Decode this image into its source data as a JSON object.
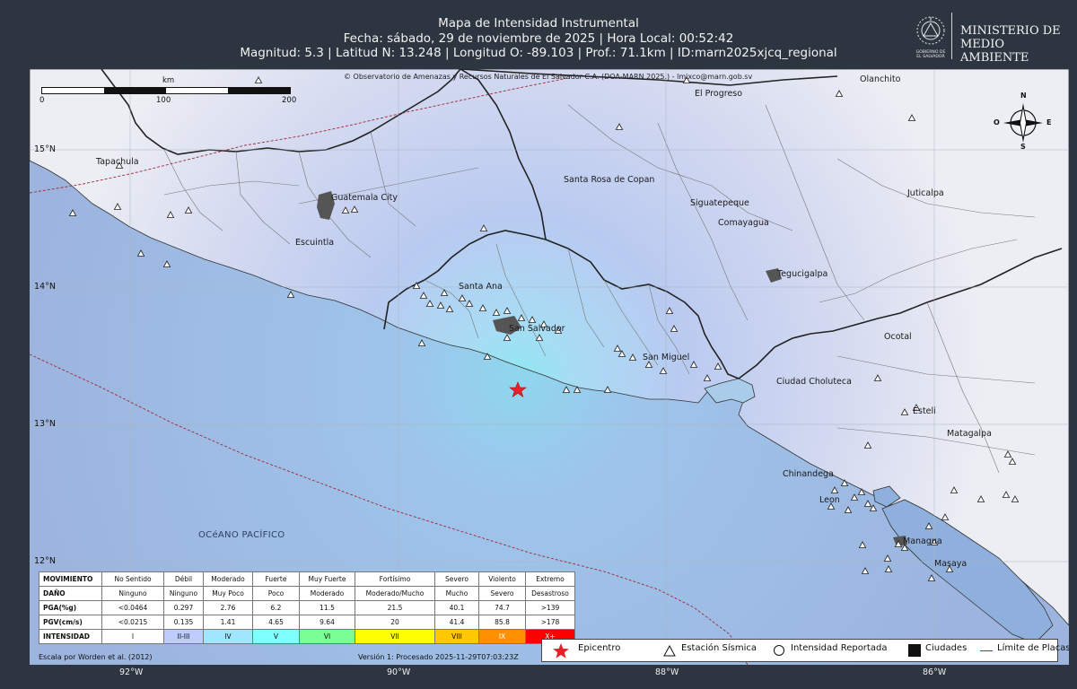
{
  "header": {
    "line1": "Mapa de Intensidad Instrumental",
    "line2": "Fecha: sábado, 29 de noviembre de 2025 | Hora Local: 00:52:42",
    "line3": "Magnitud: 5.3 | Latitud N: 13.248 | Longitud O: -89.103 | Prof.: 71.1km | ID:marn2025xjcq_regional"
  },
  "ministry": {
    "name_line1": "MINISTERIO DE",
    "name_line2": "MEDIO AMBIENTE",
    "gob_line1": "GOBIERNO DE",
    "gob_line2": "EL SALVADOR",
    "seal_icon": "government-seal-icon"
  },
  "map": {
    "copyright": "© Observatorio de Amenazas y Recursos Naturales de El Salvador  C.A. (DOA-MARN 2025.) - lmixco@marn.gob.sv",
    "ocean_label": "OCéANO PACÍFICO",
    "scale": {
      "unit": "km",
      "ticks": [
        "0",
        "100",
        "200"
      ]
    },
    "compass": {
      "n": "N",
      "s": "S",
      "e": "E",
      "o": "O"
    },
    "cities": [
      "Olanchito",
      "El Progreso",
      "Tapachula",
      "Guatemala City",
      "Santa Rosa de Copan",
      "Siguatepeque",
      "Juticalpa",
      "Comayagua",
      "Escuintla",
      "Tegucigalpa",
      "Santa Ana",
      "San Salvador",
      "Ocotal",
      "San Miguel",
      "Ciudad Choluteca",
      "Esteli",
      "Matagalpa",
      "Chinandega",
      "Leon",
      "Managua",
      "Masaya"
    ],
    "lat_labels": [
      "15°N",
      "14°N",
      "13°N",
      "12°N"
    ],
    "lon_labels": [
      "92°W",
      "90°W",
      "88°W",
      "86°W"
    ],
    "epicenter": {
      "lat": 13.248,
      "lon": -89.103
    }
  },
  "intensity_table": {
    "rows": [
      {
        "head": "MOVIMIENTO",
        "cells": [
          "No Sentido",
          "Débil",
          "Moderado",
          "Fuerte",
          "Muy Fuerte",
          "Fortísimo",
          "Severo",
          "Violento",
          "Extremo"
        ]
      },
      {
        "head": "DAÑO",
        "cells": [
          "Ninguno",
          "Ninguno",
          "Muy Poco",
          "Poco",
          "Moderado",
          "Moderado/Mucho",
          "Mucho",
          "Severo",
          "Desastroso"
        ]
      },
      {
        "head": "PGA(%g)",
        "cells": [
          "<0.0464",
          "0.297",
          "2.76",
          "6.2",
          "11.5",
          "21.5",
          "40.1",
          "74.7",
          ">139"
        ]
      },
      {
        "head": "PGV(cm/s)",
        "cells": [
          "<0.0215",
          "0.135",
          "1.41",
          "4.65",
          "9.64",
          "20",
          "41.4",
          "85.8",
          ">178"
        ]
      },
      {
        "head": "INTENSIDAD",
        "cells": [
          "I",
          "II-III",
          "IV",
          "V",
          "VI",
          "VII",
          "VIII",
          "IX",
          "X+"
        ]
      }
    ],
    "intensity_colors": [
      "#ffffff",
      "#bfccff",
      "#a0e6ff",
      "#80ffff",
      "#7aff93",
      "#ffff00",
      "#ffc800",
      "#ff9100",
      "#ff0000"
    ],
    "intensity_text_colors": [
      "#111111",
      "#111111",
      "#111111",
      "#111111",
      "#111111",
      "#111111",
      "#111111",
      "#ffffff",
      "#ffffff"
    ],
    "scale_note": "Escala por Worden et al. (2012)",
    "version_note": "Versión 1: Procesado 2025-11-29T07:03:23Z"
  },
  "legend": {
    "epicentro": "Epicentro",
    "estacion": "Estación Sísmica",
    "intensidad": "Intensidad Reportada",
    "ciudades": "Ciudades",
    "placas": "Límite de Placas"
  },
  "colors": {
    "epicenter": "#e8202a",
    "ocean": "#9db4de",
    "frame": "#2d3540"
  }
}
